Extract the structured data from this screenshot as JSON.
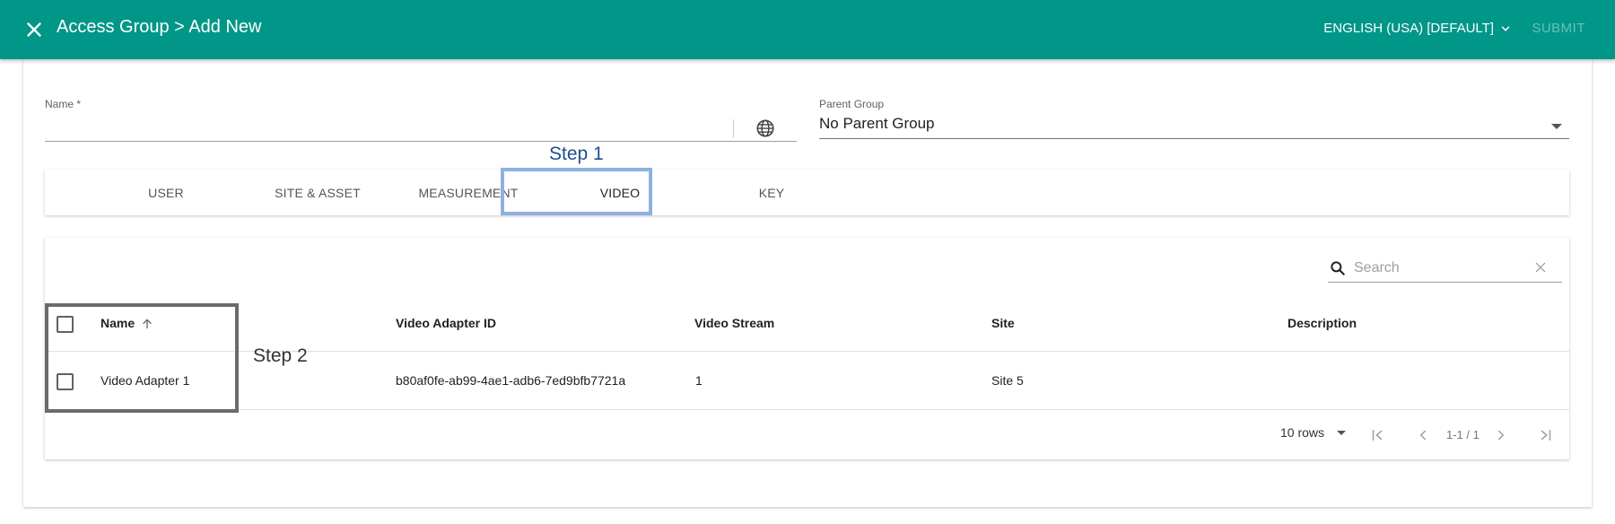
{
  "header": {
    "title": "Access Group > Add New",
    "language": "ENGLISH (USA) [DEFAULT]",
    "submit_label": "SUBMIT"
  },
  "form": {
    "name_label": "Name *",
    "parent_group_label": "Parent Group",
    "parent_group_value": "No Parent Group"
  },
  "annotations": {
    "step1": "Step 1",
    "step2": "Step 2"
  },
  "tabs": [
    {
      "label": "USER"
    },
    {
      "label": "SITE & ASSET"
    },
    {
      "label": "MEASUREMENT"
    },
    {
      "label": "VIDEO",
      "active": true
    },
    {
      "label": "KEY"
    }
  ],
  "table": {
    "search_placeholder": "Search",
    "columns": [
      "Name",
      "Video Adapter ID",
      "Video Stream",
      "Site",
      "Description"
    ],
    "rows": [
      {
        "name": "Video Adapter 1",
        "video_adapter_id": "b80af0fe-ab99-4ae1-adb6-7ed9bfb7721a",
        "video_stream": "1",
        "site": "Site 5",
        "description": ""
      }
    ],
    "rows_per_page": "10 rows",
    "page_range": "1-1 / 1"
  },
  "colors": {
    "appbar": "#009688",
    "step1_highlight": "#8fb0e0",
    "step1_text": "#1f4e8c",
    "step2_box": "#6b6b6b"
  }
}
